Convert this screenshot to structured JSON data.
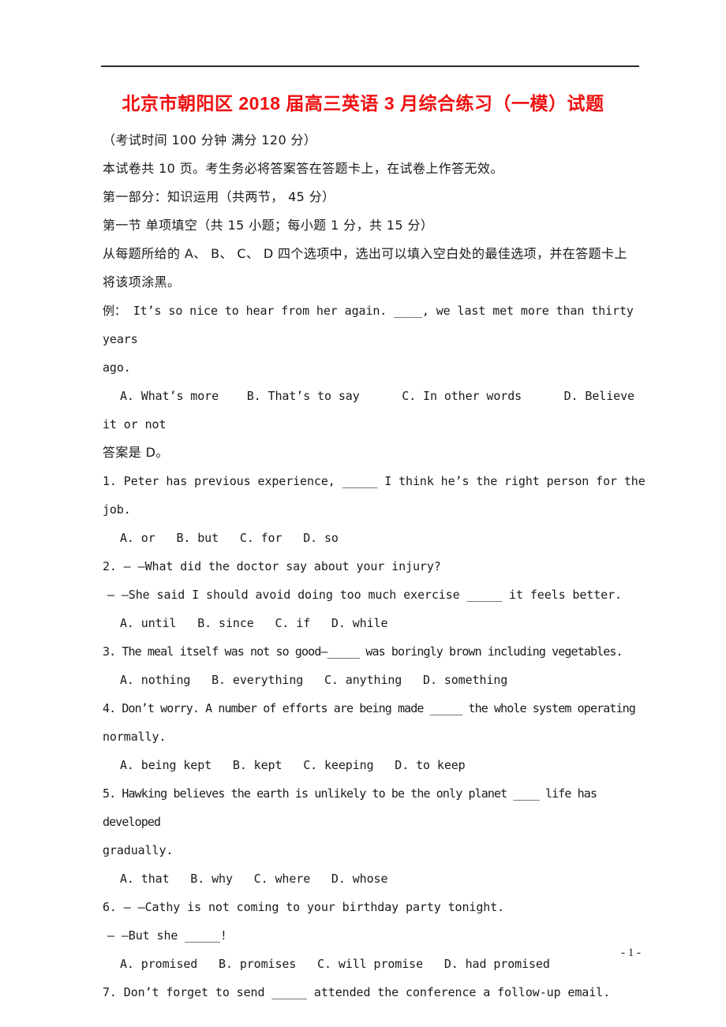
{
  "document": {
    "title": "北京市朝阳区 2018 届高三英语 3 月综合练习（一模）试题",
    "title_color": "#f01010",
    "page_number": "- 1 -"
  },
  "preamble": {
    "exam_info": "（考试时间 100 分钟 满分 120 分）",
    "paper_note": "本试卷共 10 页。考生务必将答案答在答题卡上，在试卷上作答无效。",
    "part_one": "第一部分：知识运用（共两节， 45 分）",
    "section_one": "第一节 单项填空（共 15 小题；每小题 1 分，共 15 分）",
    "instructions_line1": "从每题所给的 A、 B、 C、 D 四个选项中，选出可以填入空白处的最佳选项，并在答题卡上",
    "instructions_line2": "将该项涂黑。"
  },
  "example": {
    "stem_line1": "例： It’s so nice to hear from her again. ____, we last met more than thirty years",
    "stem_line2": "ago.",
    "options_line": "A. What’s more    B. That’s to say      C. In other words      D. Believe",
    "options_overflow": "it or not",
    "answer": "答案是 D。"
  },
  "questions": [
    {
      "number": "1",
      "lines": [
        "1. Peter has previous experience, _____ I think he’s the right person for the job."
      ],
      "options": "A. or   B. but   C. for   D. so"
    },
    {
      "number": "2",
      "lines": [
        "2. – –What did the doctor say about your injury?",
        "– –She said I should avoid doing too much exercise _____ it feels better."
      ],
      "options": "A. until   B. since   C. if   D. while"
    },
    {
      "number": "3",
      "lines": [
        "3. The meal itself was not so good—_____ was boringly brown including vegetables."
      ],
      "options": "A. nothing   B. everything   C. anything   D. something"
    },
    {
      "number": "4",
      "lines": [
        "4. Don’t worry. A number of efforts are being made _____ the whole system operating",
        "normally."
      ],
      "options": "A. being kept   B. kept   C. keeping   D. to keep"
    },
    {
      "number": "5",
      "lines": [
        "5. Hawking believes the earth is unlikely to be the only planet ____ life has developed",
        "gradually."
      ],
      "options": "A. that   B. why   C. where   D. whose"
    },
    {
      "number": "6",
      "lines": [
        "6. – –Cathy is not coming to your birthday party tonight.",
        "– –But she _____!"
      ],
      "options": "A. promised   B. promises   C. will promise   D. had promised"
    },
    {
      "number": "7",
      "lines": [
        "7. Don’t forget to send _____ attended the conference a follow-up email."
      ],
      "options": ""
    }
  ]
}
